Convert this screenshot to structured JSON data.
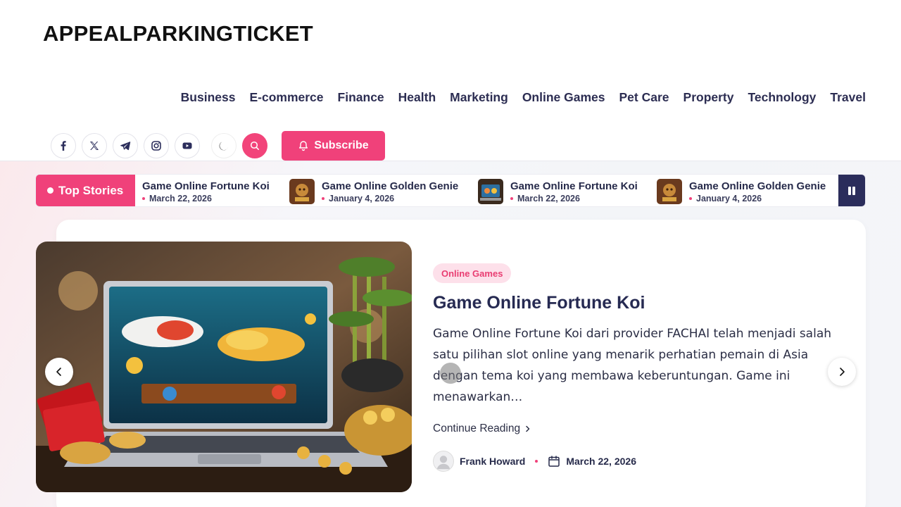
{
  "site": {
    "title": "APPEALPARKINGTICKET"
  },
  "nav": {
    "items": [
      "Business",
      "E-commerce",
      "Finance",
      "Health",
      "Marketing",
      "Online Games",
      "Pet Care",
      "Property",
      "Technology",
      "Travel"
    ]
  },
  "social": [
    "facebook-icon",
    "x-icon",
    "telegram-icon",
    "instagram-icon",
    "youtube-icon"
  ],
  "subscribe": {
    "label": "Subscribe"
  },
  "ticker": {
    "label": "Top Stories",
    "items": [
      {
        "title": "Game Online Fortune Koi",
        "date": "March 22, 2026"
      },
      {
        "title": "Game Online Golden Genie",
        "date": "January 4, 2026"
      },
      {
        "title": "Game Online Fortune Koi",
        "date": "March 22, 2026"
      },
      {
        "title": "Game Online Golden Genie",
        "date": "January 4, 2026"
      }
    ]
  },
  "featured": {
    "category": "Online Games",
    "title": "Game Online Fortune Koi",
    "excerpt": " Game Online Fortune Koi dari provider FACHAI telah menjadi salah satu pilihan slot online yang menarik perhatian pemain di Asia dengan tema koi yang membawa keberuntungan. Game ini menawarkan…",
    "continue_label": "Continue Reading",
    "author": "Frank Howard",
    "date": "March 22, 2026"
  },
  "colors": {
    "accent": "#f0417a",
    "dark": "#2b2d5b"
  }
}
